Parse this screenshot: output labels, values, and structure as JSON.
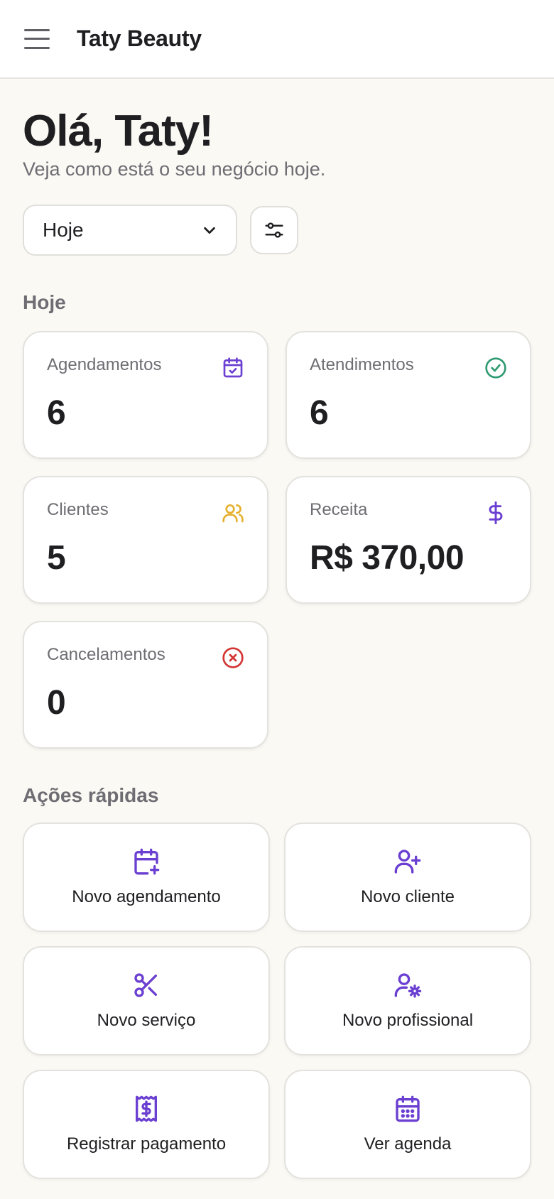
{
  "header": {
    "brand": "Taty Beauty",
    "menu_icon": "hamburger-menu-icon"
  },
  "greeting": {
    "title": "Olá, Taty!",
    "subtitle": "Veja como está o seu negócio hoje."
  },
  "filters": {
    "period_selected": "Hoje",
    "filter_icon": "sliders-icon"
  },
  "stats_section": {
    "title": "Hoje",
    "cards": [
      {
        "label": "Agendamentos",
        "value": "6",
        "icon": "calendar-check-icon",
        "color": "#6a3fd1"
      },
      {
        "label": "Atendimentos",
        "value": "6",
        "icon": "check-circle-icon",
        "color": "#2f9a72"
      },
      {
        "label": "Clientes",
        "value": "5",
        "icon": "users-icon",
        "color": "#e6b12f"
      },
      {
        "label": "Receita",
        "value": "R$ 370,00",
        "icon": "dollar-icon",
        "color": "#6a3fd1"
      },
      {
        "label": "Cancelamentos",
        "value": "0",
        "icon": "x-circle-icon",
        "color": "#d43434"
      }
    ]
  },
  "actions_section": {
    "title": "Ações rápidas",
    "items": [
      {
        "label": "Novo agendamento",
        "icon": "calendar-plus-icon"
      },
      {
        "label": "Novo cliente",
        "icon": "user-plus-icon"
      },
      {
        "label": "Novo serviço",
        "icon": "scissors-icon"
      },
      {
        "label": "Novo profissional",
        "icon": "user-cog-icon"
      },
      {
        "label": "Registrar pagamento",
        "icon": "receipt-dollar-icon"
      },
      {
        "label": "Ver agenda",
        "icon": "calendar-grid-icon"
      }
    ],
    "accent_color": "#6a3fd1"
  }
}
